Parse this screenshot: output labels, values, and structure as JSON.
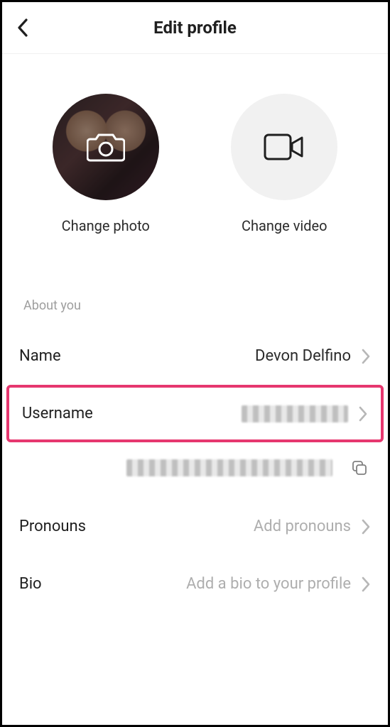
{
  "header": {
    "title": "Edit profile"
  },
  "media": {
    "photo_label": "Change photo",
    "video_label": "Change video"
  },
  "section": {
    "about_you": "About you"
  },
  "rows": {
    "name_label": "Name",
    "name_value": "Devon Delfino",
    "username_label": "Username",
    "pronouns_label": "Pronouns",
    "pronouns_placeholder": "Add pronouns",
    "bio_label": "Bio",
    "bio_placeholder": "Add a bio to your profile"
  }
}
